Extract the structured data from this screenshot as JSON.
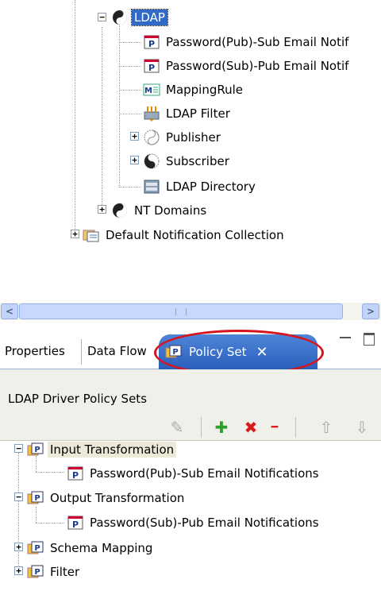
{
  "tree": {
    "items": [
      {
        "label": "LDAP",
        "icon": "driver-yinyang-icon"
      },
      {
        "label": "Password(Pub)-Sub Email Notif",
        "icon": "policy-icon"
      },
      {
        "label": "Password(Sub)-Pub Email Notif",
        "icon": "policy-icon"
      },
      {
        "label": "MappingRule",
        "icon": "mapping-rule-icon"
      },
      {
        "label": "LDAP Filter",
        "icon": "filter-icon"
      },
      {
        "label": "Publisher",
        "icon": "publisher-icon"
      },
      {
        "label": "Subscriber",
        "icon": "subscriber-icon"
      },
      {
        "label": "LDAP Directory",
        "icon": "directory-icon"
      },
      {
        "label": "NT Domains",
        "icon": "driver-yinyang-icon"
      },
      {
        "label": "Default Notification Collection",
        "icon": "notification-collection-icon"
      }
    ]
  },
  "scrollbar": {
    "left_arrow": "<",
    "right_arrow": ">"
  },
  "tabs": {
    "properties": "Properties",
    "dataflow": "Data Flow",
    "policyset": "Policy Set",
    "close": "✕"
  },
  "panel": {
    "title": "LDAP Driver Policy Sets"
  },
  "toolbar": {
    "edit": "✎",
    "add": "✚",
    "delete": "✖",
    "remove": "━",
    "up": "⇧",
    "down": "⇩"
  },
  "policyset": {
    "items": [
      {
        "label": "Input Transformation",
        "icon": "policy-set-icon"
      },
      {
        "label": "Password(Pub)-Sub Email Notifications",
        "icon": "policy-icon"
      },
      {
        "label": "Output Transformation",
        "icon": "policy-set-icon"
      },
      {
        "label": "Password(Sub)-Pub Email Notifications",
        "icon": "policy-icon"
      },
      {
        "label": "Schema Mapping",
        "icon": "policy-set-icon"
      },
      {
        "label": "Filter",
        "icon": "policy-set-icon"
      }
    ]
  },
  "colors": {
    "selection": "#3169c6",
    "active_tab": "#2a5fbd",
    "annotation_ellipse": "#d8141c"
  }
}
